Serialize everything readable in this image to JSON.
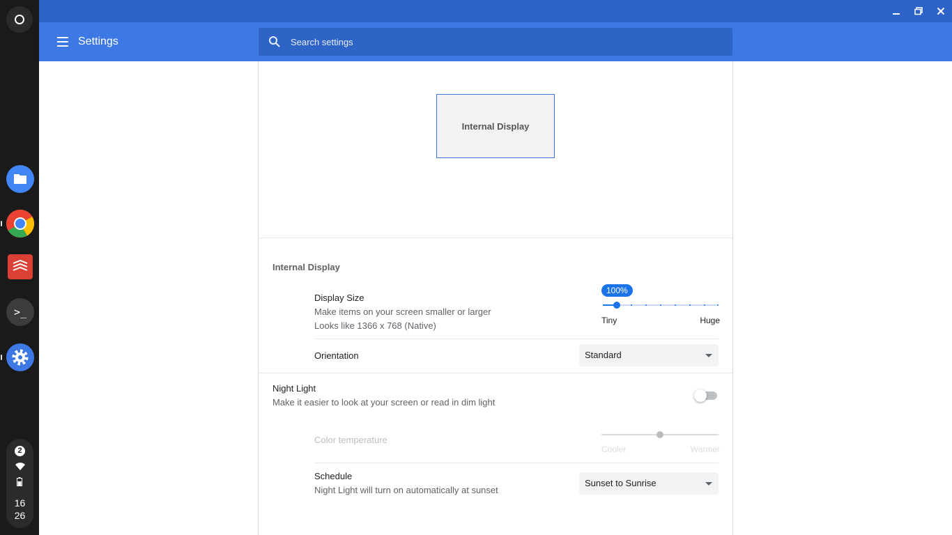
{
  "shelf": {
    "notification_count": "2",
    "clock_hour": "16",
    "clock_minute": "26",
    "apps": [
      {
        "name": "files",
        "color": "#4285f4"
      },
      {
        "name": "chrome",
        "color": "#ea4335"
      },
      {
        "name": "todoist",
        "color": "#db4035"
      },
      {
        "name": "terminal",
        "color": "#3c3c3c"
      },
      {
        "name": "settings",
        "color": "#3e78e4"
      }
    ]
  },
  "header": {
    "title": "Settings",
    "search_placeholder": "Search settings"
  },
  "display": {
    "arrangement_label": "Internal Display",
    "section_title": "Internal Display",
    "display_size": {
      "title": "Display Size",
      "description": "Make items on your screen smaller or larger",
      "resolution": "Looks like 1366 x 768 (Native)",
      "value": "100%",
      "min_label": "Tiny",
      "max_label": "Huge"
    },
    "orientation": {
      "title": "Orientation",
      "value": "Standard"
    }
  },
  "night_light": {
    "title": "Night Light",
    "description": "Make it easier to look at your screen or read in dim light",
    "enabled": false,
    "color_temperature": {
      "title": "Color temperature",
      "min_label": "Cooler",
      "max_label": "Warmer"
    },
    "schedule": {
      "title": "Schedule",
      "description": "Night Light will turn on automatically at sunset",
      "value": "Sunset to Sunrise"
    }
  },
  "colors": {
    "titlebar": "#2d62c8",
    "header": "#3e78e4",
    "accent": "#1a73e8"
  }
}
